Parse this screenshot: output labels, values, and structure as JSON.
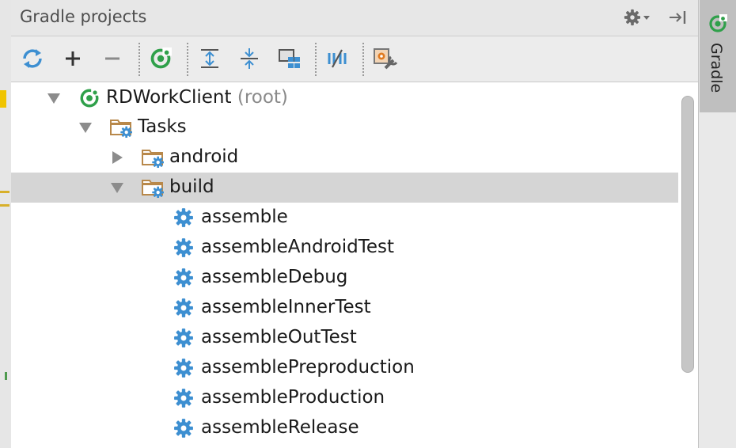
{
  "panel": {
    "title": "Gradle projects"
  },
  "side_tab": {
    "label": "Gradle"
  },
  "toolbar": {
    "buttons": [
      {
        "name": "refresh-icon"
      },
      {
        "name": "add-icon"
      },
      {
        "name": "remove-icon"
      },
      {
        "name": "gradle-execute-icon"
      },
      {
        "name": "expand-all-icon"
      },
      {
        "name": "collapse-all-icon"
      },
      {
        "name": "group-modules-icon"
      },
      {
        "name": "toggle-offline-icon"
      },
      {
        "name": "gradle-settings-icon"
      }
    ]
  },
  "colors": {
    "accent_green": "#2fa04a",
    "gear_blue": "#3d8fd1",
    "folder_brown": "#b8884a",
    "selected_row": "#d5d5d5"
  },
  "tree": {
    "root": {
      "label": "RDWorkClient",
      "suffix": "(root)"
    },
    "tasks": {
      "label": "Tasks"
    },
    "android": {
      "label": "android"
    },
    "build": {
      "label": "build"
    },
    "tasks_list": [
      {
        "label": "assemble"
      },
      {
        "label": "assembleAndroidTest"
      },
      {
        "label": "assembleDebug"
      },
      {
        "label": "assembleInnerTest"
      },
      {
        "label": "assembleOutTest"
      },
      {
        "label": "assemblePreproduction"
      },
      {
        "label": "assembleProduction"
      },
      {
        "label": "assembleRelease"
      }
    ]
  }
}
